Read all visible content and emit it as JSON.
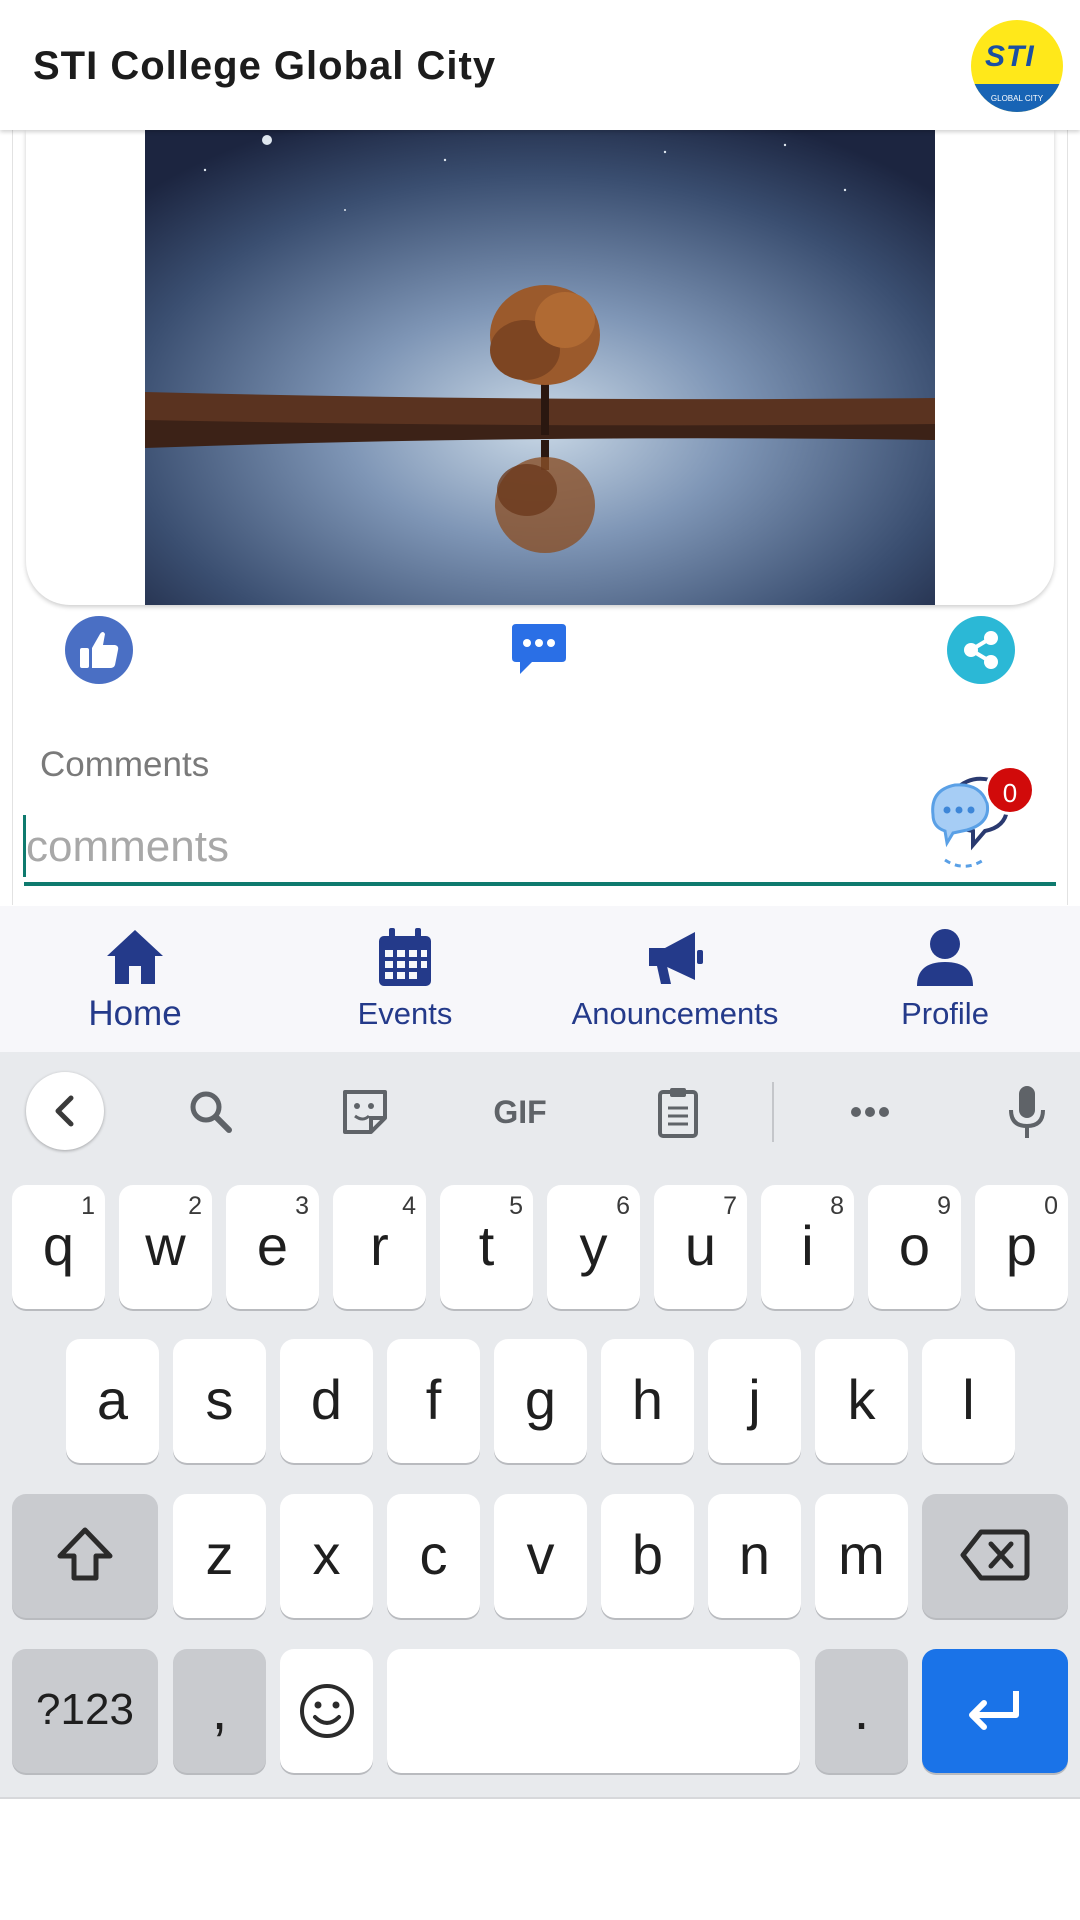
{
  "header": {
    "title": "STI College Global City",
    "logo_text": "STI",
    "logo_subtext": "GLOBAL CITY"
  },
  "post": {
    "image_icon": "photo-tree-reflection",
    "actions": [
      {
        "name": "like",
        "icon": "thumbs-up-icon"
      },
      {
        "name": "comment",
        "icon": "chat-bubble-icon"
      },
      {
        "name": "share",
        "icon": "share-icon"
      }
    ],
    "comments_label": "Comments",
    "comment_input": {
      "placeholder": "comments",
      "value": ""
    },
    "comment_count": "0"
  },
  "bottom_nav": {
    "items": [
      {
        "label": "Home",
        "icon": "home-icon",
        "active": true
      },
      {
        "label": "Events",
        "icon": "calendar-icon",
        "active": false
      },
      {
        "label": "Anouncements",
        "icon": "megaphone-icon",
        "active": false
      },
      {
        "label": "Profile",
        "icon": "user-icon",
        "active": false
      }
    ]
  },
  "keyboard": {
    "toolbar": [
      "back-arrow-icon",
      "search-icon",
      "sticker-icon",
      "gif-icon",
      "clipboard-icon",
      "more-icon",
      "microphone-icon"
    ],
    "gif_label": "GIF",
    "row1": [
      {
        "key": "q",
        "hint": "1"
      },
      {
        "key": "w",
        "hint": "2"
      },
      {
        "key": "e",
        "hint": "3"
      },
      {
        "key": "r",
        "hint": "4"
      },
      {
        "key": "t",
        "hint": "5"
      },
      {
        "key": "y",
        "hint": "6"
      },
      {
        "key": "u",
        "hint": "7"
      },
      {
        "key": "i",
        "hint": "8"
      },
      {
        "key": "o",
        "hint": "9"
      },
      {
        "key": "p",
        "hint": "0"
      }
    ],
    "row2": [
      "a",
      "s",
      "d",
      "f",
      "g",
      "h",
      "j",
      "k",
      "l"
    ],
    "row3": [
      "z",
      "x",
      "c",
      "v",
      "b",
      "n",
      "m"
    ],
    "row4": {
      "symbols": "?123",
      "comma": ",",
      "period": "."
    }
  },
  "colors": {
    "accent": "#243a8a",
    "input_underline": "#0e7a6e",
    "badge": "#d10a0a",
    "enter_key": "#1a73e8",
    "like": "#4a6fc4",
    "share": "#2bb8d6"
  }
}
